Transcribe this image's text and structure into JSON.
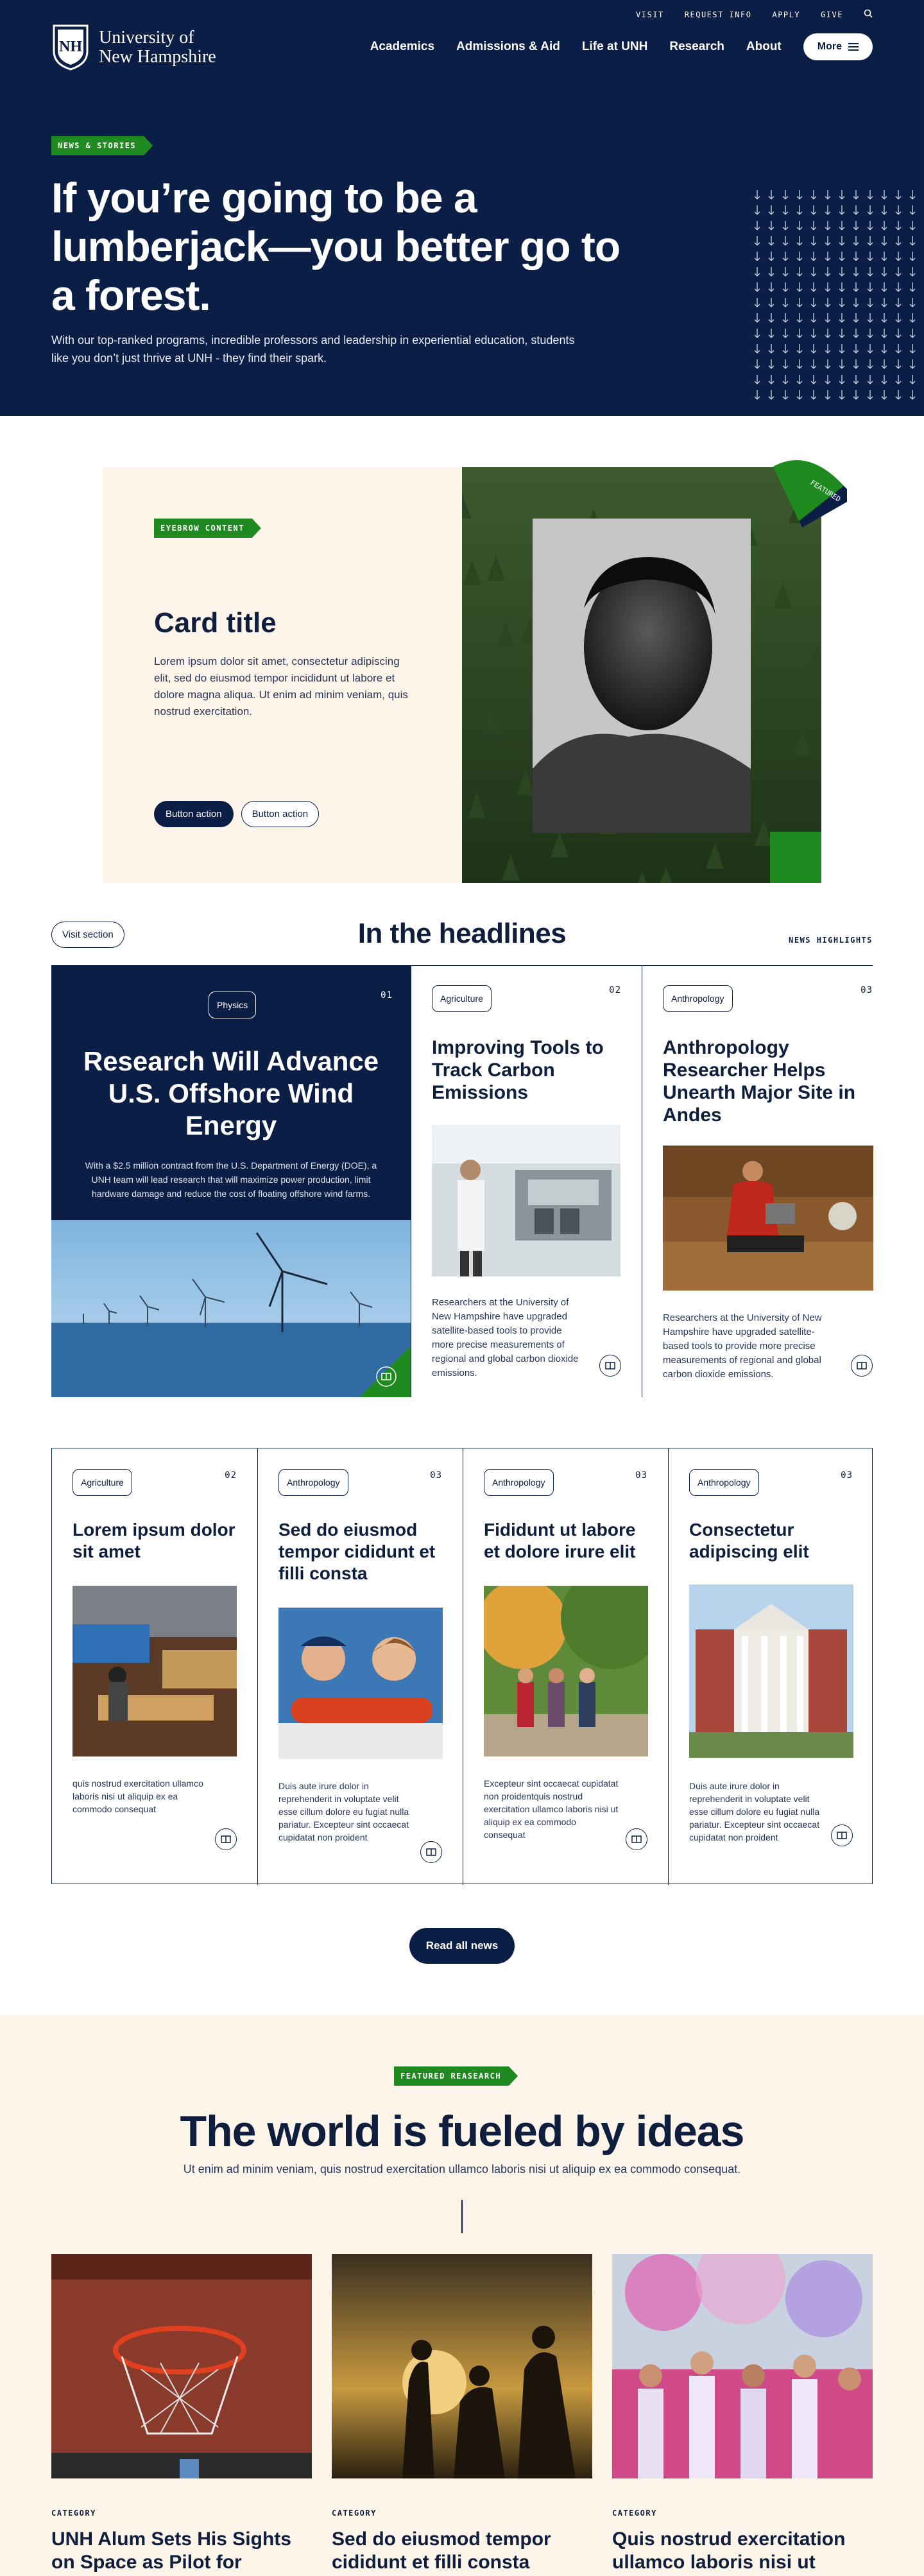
{
  "header": {
    "util_nav": [
      "VISIT",
      "REQUEST INFO",
      "APPLY",
      "GIVE"
    ],
    "logo_line1": "University of",
    "logo_line2": "New Hampshire",
    "main_nav": [
      "Academics",
      "Admissions & Aid",
      "Life at UNH",
      "Research",
      "About"
    ],
    "more_label": "More"
  },
  "hero": {
    "eyebrow": "NEWS & STORIES",
    "title": "If you’re going to be a lumberjack—you better go to a forest.",
    "text": "With our top-ranked programs, incredible professors and leadership in experiential education, students like you don’t just thrive at UNH - they find their spark."
  },
  "feature": {
    "eyebrow": "EYEBROW CONTENT",
    "title": "Card title",
    "desc": "Lorem ipsum dolor sit amet, consectetur adipiscing elit, sed do eiusmod tempor incididunt ut labore et dolore magna aliqua. Ut enim ad minim veniam, quis nostrud exercitation.",
    "btn_primary": "Button action",
    "btn_secondary": "Button action",
    "badge": "FEATURED"
  },
  "headlines": {
    "visit_label": "Visit section",
    "title": "In the headlines",
    "label": "NEWS HIGHLIGHTS",
    "featured": {
      "tag": "Physics",
      "num": "01",
      "title": "Research Will Advance U.S. Offshore Wind Energy",
      "summary": "With a $2.5 million contract from the U.S. Department of Energy (DOE), a UNH team will lead research that will maximize power production, limit hardware damage and reduce the cost of floating offshore wind farms."
    },
    "cards": [
      {
        "tag": "Agriculture",
        "num": "02",
        "title": "Improving Tools to Track Carbon Emissions",
        "summary": "Researchers at the University of New Hampshire have upgraded satellite-based tools to provide more precise measurements of regional and global carbon dioxide emissions."
      },
      {
        "tag": "Anthropology",
        "num": "03",
        "title": "Anthropology Researcher Helps Unearth Major Site in Andes",
        "summary": "Researchers at the University of New Hampshire have upgraded satellite-based tools to provide more precise measurements of regional and global carbon dioxide emissions."
      }
    ],
    "grid": [
      {
        "tag": "Agriculture",
        "num": "02",
        "title": "Lorem ipsum dolor sit amet",
        "summary": "quis nostrud exercitation ullamco laboris nisi ut aliquip ex ea commodo consequat"
      },
      {
        "tag": "Anthropology",
        "num": "03",
        "title": "Sed do eiusmod tempor cididunt et filli consta",
        "summary": "Duis aute irure dolor in reprehenderit in voluptate velit esse cillum dolore eu fugiat nulla pariatur. Excepteur sint occaecat cupidatat non proident"
      },
      {
        "tag": "Anthropology",
        "num": "03",
        "title": "Fididunt ut labore et dolore irure elit",
        "summary": " Excepteur sint occaecat cupidatat non proidentquis nostrud exercitation ullamco laboris nisi ut aliquip ex ea commodo consequat"
      },
      {
        "tag": "Anthropology",
        "num": "03",
        "title": "Consectetur adipiscing elit",
        "summary": "Duis aute irure dolor in reprehenderit in voluptate velit esse cillum dolore eu fugiat nulla pariatur. Excepteur sint occaecat cupidatat non proident"
      }
    ],
    "read_all": "Read all news"
  },
  "research": {
    "eyebrow": "FEATURED REASEARCH",
    "title": "The world is fueled by ideas",
    "sub": "Ut enim ad minim veniam, quis nostrud exercitation ullamco laboris nisi ut aliquip ex ea commodo consequat.",
    "cards": [
      {
        "cat": "CATEGORY",
        "title": "UNH Alum Sets His Sights on Space as Pilot for SpaceX Polaris Dawn Mission"
      },
      {
        "cat": "CATEGORY",
        "title": "Sed do eiusmod tempor cididunt et filli consta"
      },
      {
        "cat": "CATEGORY",
        "title": "Quis nostrud exercitation ullamco laboris nisi ut aliquip ex ea commodo"
      }
    ]
  },
  "colors": {
    "navy": "#0b1e45",
    "green": "#1f8a1f",
    "cream": "#fdf4ea"
  },
  "icons": [
    "unh-logo-icon",
    "search-icon",
    "menu-icon",
    "arrow-down-pattern",
    "book-icon"
  ]
}
